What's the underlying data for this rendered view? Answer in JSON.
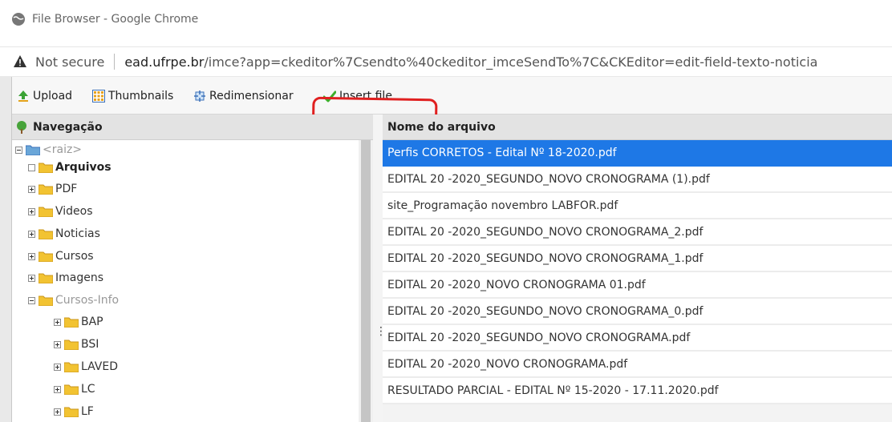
{
  "window": {
    "title": "File Browser - Google Chrome"
  },
  "address": {
    "security": "Not secure",
    "url_host": "ead.ufrpe.br",
    "url_rest": "/imce?app=ckeditor%7Csendto%40ckeditor_imceSendTo%7C&CKEditor=edit-field-texto-noticia"
  },
  "toolbar": {
    "upload": "Upload",
    "thumbnails": "Thumbnails",
    "resize": "Redimensionar",
    "insert": "Insert file"
  },
  "nav": {
    "title": "Navegação",
    "root": "<raiz>",
    "items": [
      {
        "label": "Arquivos",
        "toggle": "empty"
      },
      {
        "label": "PDF",
        "toggle": "plus"
      },
      {
        "label": "Videos",
        "toggle": "plus"
      },
      {
        "label": "Noticias",
        "toggle": "plus"
      },
      {
        "label": "Cursos",
        "toggle": "plus"
      },
      {
        "label": "Imagens",
        "toggle": "plus"
      },
      {
        "label": "Cursos-Info",
        "toggle": "minus"
      },
      {
        "label": "BAP",
        "toggle": "plus"
      },
      {
        "label": "BSI",
        "toggle": "plus"
      },
      {
        "label": "LAVED",
        "toggle": "plus"
      },
      {
        "label": "LC",
        "toggle": "plus"
      },
      {
        "label": "LF",
        "toggle": "plus"
      }
    ]
  },
  "files": {
    "header": "Nome do arquivo",
    "rows": [
      "Perfis CORRETOS - Edital Nº 18-2020.pdf",
      "EDITAL 20 -2020_SEGUNDO_NOVO CRONOGRAMA (1).pdf",
      "site_Programação novembro LABFOR.pdf",
      "EDITAL 20 -2020_SEGUNDO_NOVO CRONOGRAMA_2.pdf",
      "EDITAL 20 -2020_SEGUNDO_NOVO CRONOGRAMA_1.pdf",
      "EDITAL 20 -2020_NOVO CRONOGRAMA 01.pdf",
      "EDITAL 20 -2020_SEGUNDO_NOVO CRONOGRAMA_0.pdf",
      "EDITAL 20 -2020_SEGUNDO_NOVO CRONOGRAMA.pdf",
      "EDITAL 20 -2020_NOVO CRONOGRAMA.pdf",
      "RESULTADO PARCIAL - EDITAL Nº 15-2020 - 17.11.2020.pdf"
    ]
  },
  "colors": {
    "selection": "#1e78e6",
    "highlight": "#e02020"
  }
}
